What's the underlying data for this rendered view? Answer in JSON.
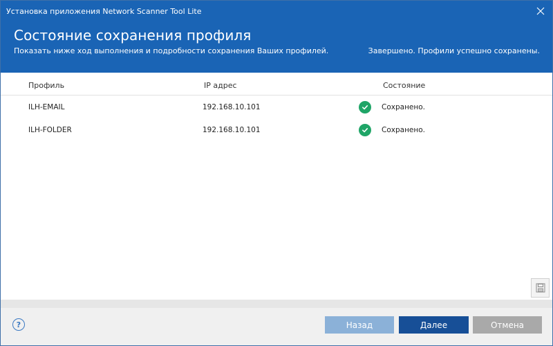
{
  "window": {
    "title": "Установка приложения Network Scanner Tool Lite"
  },
  "header": {
    "title": "Состояние сохранения профиля",
    "subtitle": "Показать ниже ход выполнения и подробности сохранения Ваших профилей.",
    "status": "Завершено. Профили успешно сохранены."
  },
  "table": {
    "columns": {
      "profile": "Профиль",
      "ip": "IP адрес",
      "state": "Состояние"
    },
    "rows": [
      {
        "profile": "ILH-EMAIL",
        "ip": "192.168.10.101",
        "state": "Сохранено."
      },
      {
        "profile": "ILH-FOLDER",
        "ip": "192.168.10.101",
        "state": "Сохранено."
      }
    ]
  },
  "footer": {
    "help_label": "?",
    "back_label": "Назад",
    "next_label": "Далее",
    "cancel_label": "Отмена"
  },
  "icons": {
    "close": "close-icon",
    "check": "check-circle-icon",
    "save": "floppy-disk-icon",
    "help": "help-icon"
  },
  "colors": {
    "header_bg": "#1a64b5",
    "success": "#1fa567",
    "primary_button": "#174f97",
    "disabled_button": "#8bb1d8",
    "cancel_button": "#a9a9a9"
  }
}
